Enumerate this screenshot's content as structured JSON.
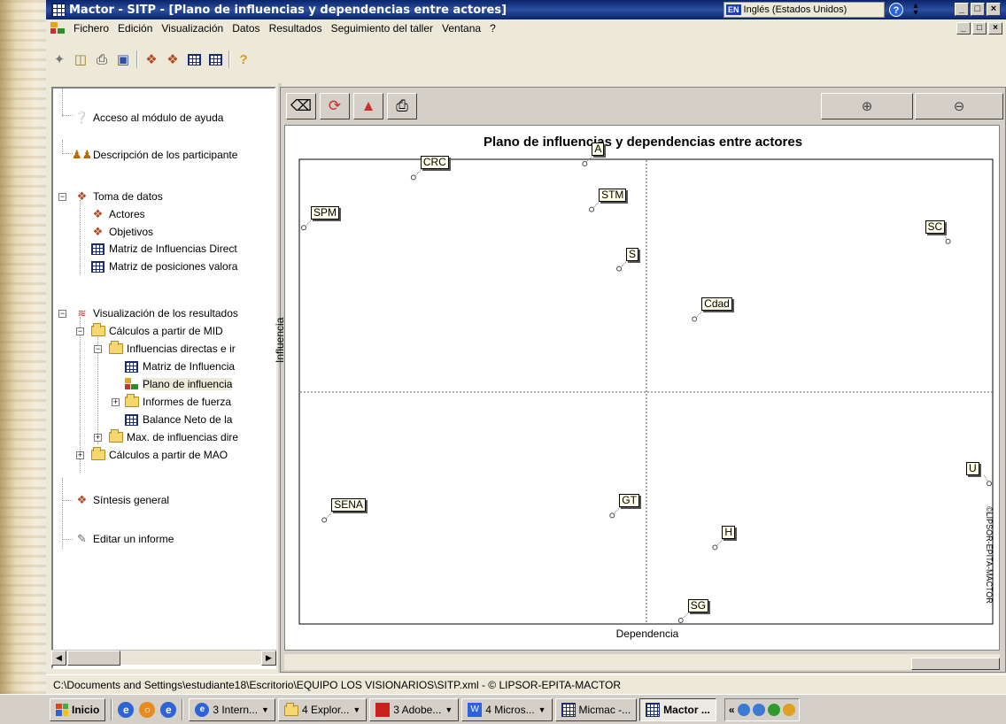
{
  "window": {
    "title": "Mactor  -  SITP - [Plano de influencias y dependencias entre actores]",
    "language_code": "EN",
    "language_label": "Inglés (Estados Unidos)",
    "buttons": [
      "_",
      "□",
      "×"
    ]
  },
  "menu": {
    "items": [
      "Fichero",
      "Edición",
      "Visualización",
      "Datos",
      "Resultados",
      "Seguimiento del taller",
      "Ventana",
      "?"
    ]
  },
  "tree": {
    "items": [
      {
        "label": "Acceso al módulo de ayuda",
        "icon": "help-icon"
      },
      {
        "label": "Descripción de los participante",
        "icon": "people-icon"
      },
      {
        "label": "Toma de datos",
        "icon": "data-icon"
      },
      {
        "label": "Actores",
        "icon": "data-icon"
      },
      {
        "label": "Objetivos",
        "icon": "data-icon"
      },
      {
        "label": "Matriz de Influencias Direct",
        "icon": "grid-icon"
      },
      {
        "label": "Matriz de posiciones valora",
        "icon": "grid-icon"
      },
      {
        "label": "Visualización de los resultados",
        "icon": "chart-icon"
      },
      {
        "label": "Cálculos a partir de MID",
        "icon": "folder-icon"
      },
      {
        "label": "Influencias directas e ir",
        "icon": "folder-icon"
      },
      {
        "label": "Matriz de Influencia",
        "icon": "grid-icon"
      },
      {
        "label": "Plano de influencia",
        "icon": "plane-icon"
      },
      {
        "label": "Informes de fuerza",
        "icon": "folder-icon"
      },
      {
        "label": "Balance Neto de la",
        "icon": "grid-icon"
      },
      {
        "label": "Max. de influencias dire",
        "icon": "folder-icon"
      },
      {
        "label": "Cálculos a partir de MAO",
        "icon": "folder-icon"
      },
      {
        "label": "Síntesis general",
        "icon": "data-icon"
      },
      {
        "label": "Editar un informe",
        "icon": "report-icon"
      }
    ]
  },
  "chart_data": {
    "type": "scatter",
    "title": "Plano de influencias y dependencias entre actores",
    "xlabel": "Dependencia",
    "ylabel": "Influencia",
    "watermark": "©LIPSOR-EPITA-MACTOR",
    "xlim": [
      0,
      100
    ],
    "ylim": [
      0,
      100
    ],
    "quadrant_split": {
      "x": 50,
      "y": 50
    },
    "grid": false,
    "points": [
      {
        "label": "A",
        "x": 41,
        "y": 100
      },
      {
        "label": "CRC",
        "x": 16,
        "y": 97
      },
      {
        "label": "STM",
        "x": 42,
        "y": 90
      },
      {
        "label": "SPM",
        "x": 0,
        "y": 86
      },
      {
        "label": "SC",
        "x": 94,
        "y": 83
      },
      {
        "label": "S",
        "x": 46,
        "y": 77
      },
      {
        "label": "Cdad",
        "x": 57,
        "y": 66
      },
      {
        "label": "U",
        "x": 100,
        "y": 30
      },
      {
        "label": "SENA",
        "x": 3,
        "y": 22
      },
      {
        "label": "GT",
        "x": 45,
        "y": 23
      },
      {
        "label": "H",
        "x": 60,
        "y": 16
      },
      {
        "label": "SG",
        "x": 55,
        "y": 0
      }
    ]
  },
  "status": {
    "path": "C:\\Documents and Settings\\estudiante18\\Escritorio\\EQUIPO LOS VISIONARIOS\\SITP.xml  - © LIPSOR-EPITA-MACTOR"
  },
  "taskbar": {
    "start": "Inicio",
    "tasks": [
      "3 Intern...",
      "4 Explor...",
      "3 Adobe...",
      "4 Micros...",
      "Micmac  -...",
      "Mactor  ..."
    ],
    "tray_toggle": "«"
  }
}
